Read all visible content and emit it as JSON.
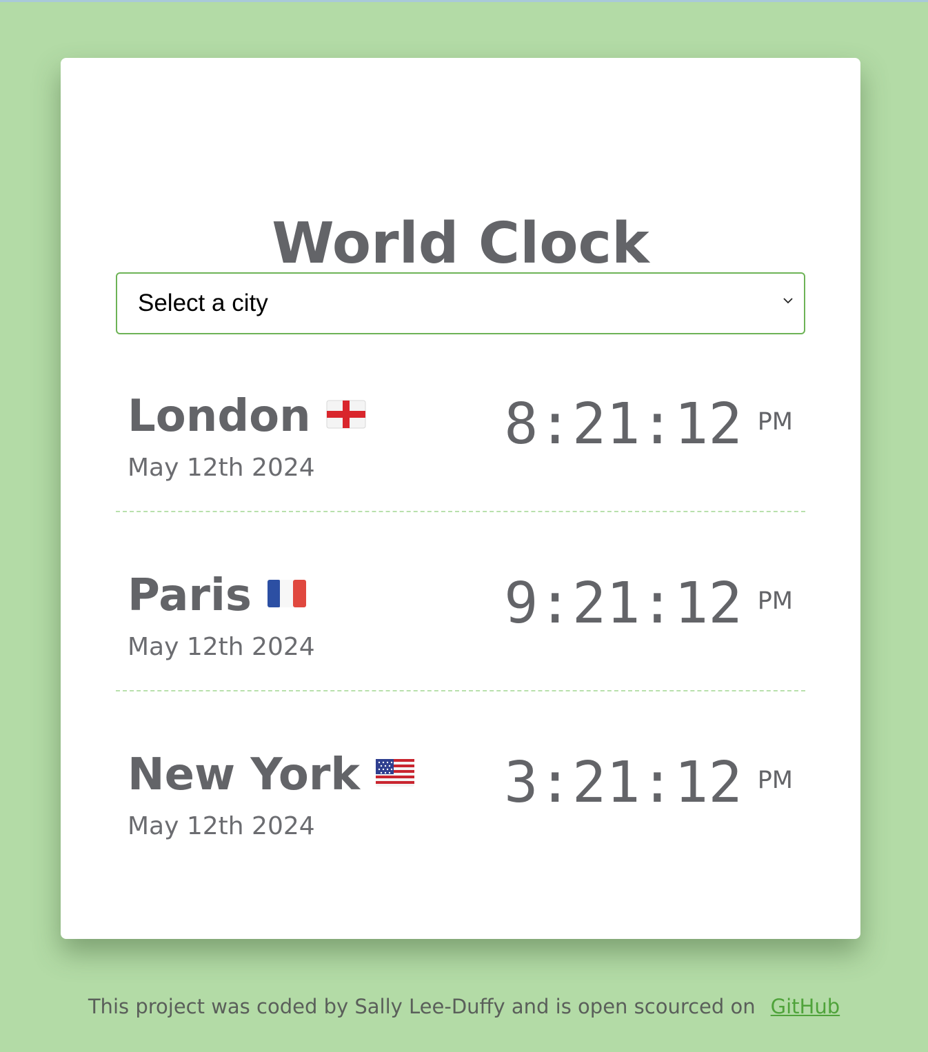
{
  "app": {
    "title": "World Clock"
  },
  "city_select": {
    "value": "Select a city"
  },
  "cities": [
    {
      "name": "London",
      "flag": "england-flag-icon",
      "date": "May 12th 2024",
      "time": "8:21:12",
      "ampm": "PM"
    },
    {
      "name": "Paris",
      "flag": "france-flag-icon",
      "date": "May 12th 2024",
      "time": "9:21:12",
      "ampm": "PM"
    },
    {
      "name": "New York",
      "flag": "usa-flag-icon",
      "date": "May 12th 2024",
      "time": "3:21:12",
      "ampm": "PM"
    }
  ],
  "footer": {
    "text": "This project was coded by Sally Lee-Duffy and is open scourced on",
    "link_label": "GitHub"
  },
  "colors": {
    "background": "#b3dba6",
    "accent": "#6db356",
    "link": "#4fa33a",
    "text": "#636468"
  }
}
